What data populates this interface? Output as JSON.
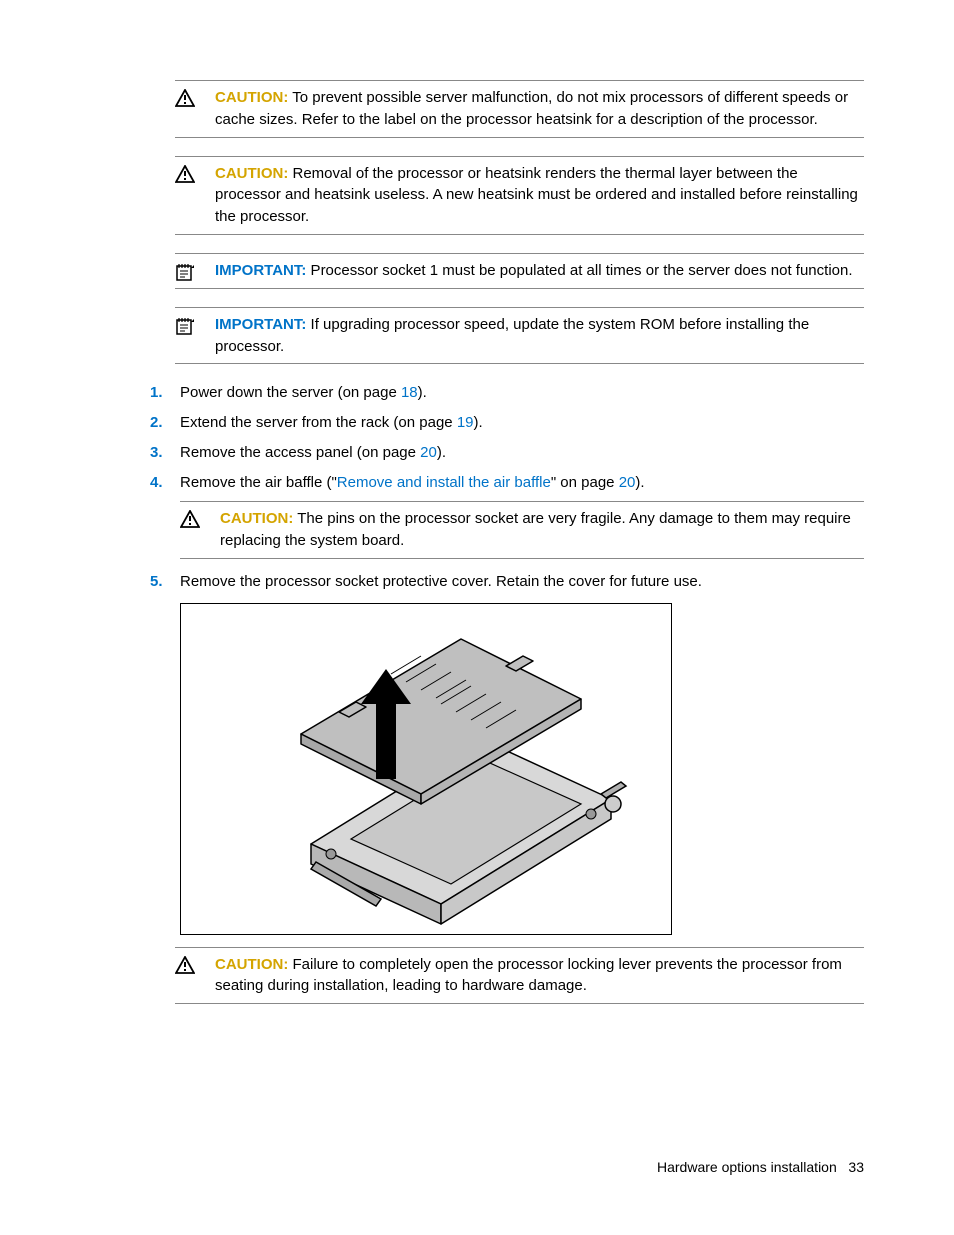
{
  "admonitions": {
    "a1": {
      "label": "CAUTION:",
      "text": " To prevent possible server malfunction, do not mix processors of different speeds or cache sizes. Refer to the label on the processor heatsink for a description of the processor."
    },
    "a2": {
      "label": "CAUTION:",
      "text": " Removal of the processor or heatsink renders the thermal layer between the processor and heatsink useless. A new heatsink must be ordered and installed before reinstalling the processor."
    },
    "a3": {
      "label": "IMPORTANT:",
      "text": " Processor socket 1 must be populated at all times or the server does not function."
    },
    "a4": {
      "label": "IMPORTANT:",
      "text": " If upgrading processor speed, update the system ROM before installing the processor."
    },
    "a5": {
      "label": "CAUTION:",
      "text": " The pins on the processor socket are very fragile. Any damage to them may require replacing the system board."
    },
    "a6": {
      "label": "CAUTION:",
      "text": " Failure to completely open the processor locking lever prevents the processor from seating during installation, leading to hardware damage."
    }
  },
  "steps": {
    "s1": {
      "num": "1.",
      "pre": "Power down the server (on page ",
      "link": "18",
      "post": ")."
    },
    "s2": {
      "num": "2.",
      "pre": "Extend the server from the rack (on page ",
      "link": "19",
      "post": ")."
    },
    "s3": {
      "num": "3.",
      "pre": "Remove the access panel (on page ",
      "link": "20",
      "post": ")."
    },
    "s4": {
      "num": "4.",
      "pre": "Remove the air baffle (\"",
      "link1": "Remove and install the air baffle",
      "mid": "\" on page ",
      "link2": "20",
      "post": ")."
    },
    "s5": {
      "num": "5.",
      "text": "Remove the processor socket protective cover. Retain the cover for future use."
    }
  },
  "footer": {
    "section": "Hardware options installation",
    "page": "33"
  }
}
